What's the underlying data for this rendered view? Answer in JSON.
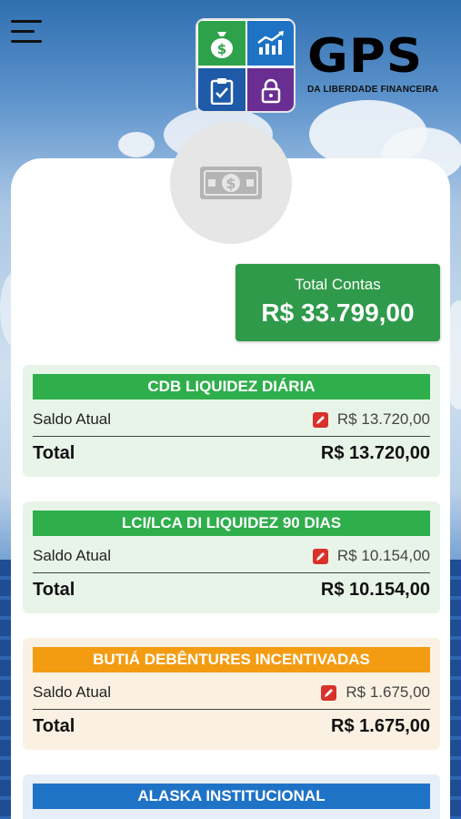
{
  "header": {
    "logo_word": "GPS",
    "logo_subtitle": "DA LIBERDADE FINANCEIRA"
  },
  "summary": {
    "label": "Total Contas",
    "value": "R$ 33.799,00"
  },
  "accounts": [
    {
      "title": "CDB LIQUIDEZ DIÁRIA",
      "saldo_label": "Saldo Atual",
      "saldo_value": "R$ 13.720,00",
      "total_label": "Total",
      "total_value": "R$ 13.720,00",
      "color": "#2fae4c"
    },
    {
      "title": "LCI/LCA DI LIQUIDEZ 90 DIAS",
      "saldo_label": "Saldo Atual",
      "saldo_value": "R$ 10.154,00",
      "total_label": "Total",
      "total_value": "R$ 10.154,00",
      "color": "#2fae4c"
    },
    {
      "title": "BUTIÁ DEBÊNTURES INCENTIVADAS",
      "saldo_label": "Saldo Atual",
      "saldo_value": "R$ 1.675,00",
      "total_label": "Total",
      "total_value": "R$ 1.675,00",
      "color": "#f39c12"
    },
    {
      "title": "ALASKA INSTITUCIONAL",
      "color": "#1f73c6"
    }
  ],
  "icons": {
    "menu": "hamburger-menu-icon",
    "avatar": "money-bill-icon",
    "edit": "pencil-edit-icon"
  }
}
